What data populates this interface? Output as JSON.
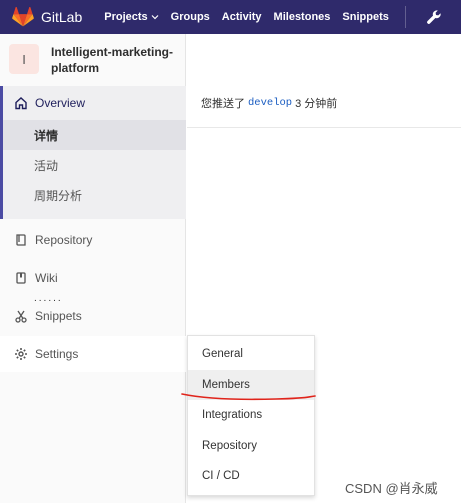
{
  "navbar": {
    "brand": "GitLab",
    "links": [
      "Projects",
      "Groups",
      "Activity",
      "Milestones",
      "Snippets"
    ],
    "background": "#2f2a6b"
  },
  "sidebar": {
    "project_avatar": "I",
    "project_name": "Intelligent-marketing-platform",
    "overview": {
      "label": "Overview",
      "sub_items": [
        "详情",
        "活动",
        "周期分析"
      ],
      "active_sub": "详情"
    },
    "items": {
      "repository": "Repository",
      "wiki": "Wiki",
      "dots": "......",
      "snippets": "Snippets",
      "settings": "Settings"
    }
  },
  "main": {
    "activity": {
      "prefix": "您推送了",
      "branch": "develop",
      "suffix": "3 分钟前"
    }
  },
  "settings_flyout": {
    "items": [
      "General",
      "Members",
      "Integrations",
      "Repository",
      "CI / CD"
    ],
    "hovered": "Members"
  },
  "watermark": "CSDN @肖永威",
  "colors": {
    "accent": "#4b4ba3",
    "link": "#1b5dc1",
    "annotation": "#e0241b"
  }
}
